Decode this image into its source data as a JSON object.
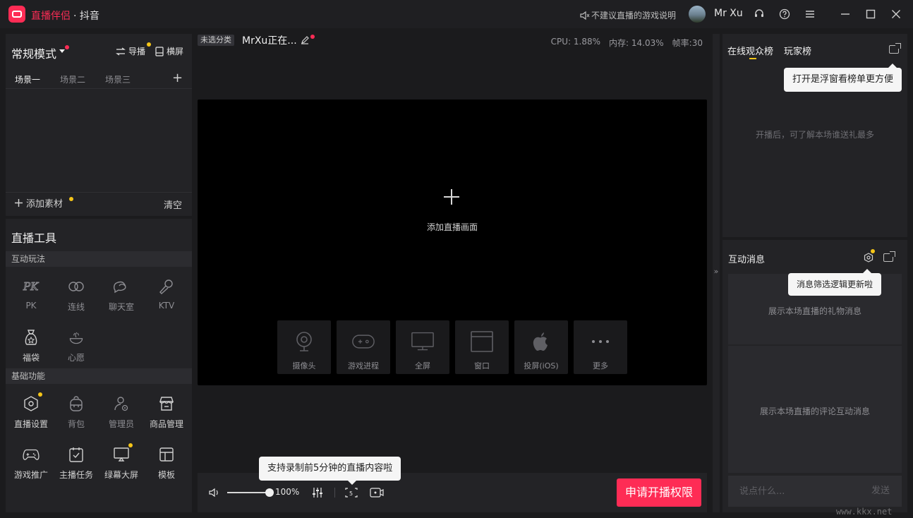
{
  "titlebar": {
    "app_name": "直播伴侣",
    "app_sub": "· 抖音",
    "notice": "不建议直播的游戏说明",
    "username": "Mr Xu"
  },
  "left": {
    "mode": "常规模式",
    "guide": "导播",
    "landscape": "横屏",
    "scenes": [
      "场景一",
      "场景二",
      "场景三"
    ],
    "add_source": "添加素材",
    "clear": "清空",
    "tools_title": "直播工具",
    "section_interactive": "互动玩法",
    "interactive_tools": [
      {
        "label": "PK",
        "icon": "pk-icon"
      },
      {
        "label": "连线",
        "icon": "link-icon"
      },
      {
        "label": "聊天室",
        "icon": "chatroom-icon"
      },
      {
        "label": "KTV",
        "icon": "microphone-icon"
      },
      {
        "label": "福袋",
        "icon": "lucky-bag-icon"
      },
      {
        "label": "心愿",
        "icon": "wish-icon"
      }
    ],
    "section_basic": "基础功能",
    "basic_tools": [
      {
        "label": "直播设置",
        "icon": "settings-hex-icon"
      },
      {
        "label": "背包",
        "icon": "backpack-icon"
      },
      {
        "label": "管理员",
        "icon": "admin-icon"
      },
      {
        "label": "商品管理",
        "icon": "store-icon"
      },
      {
        "label": "游戏推广",
        "icon": "gamepad-icon"
      },
      {
        "label": "主播任务",
        "icon": "task-icon"
      },
      {
        "label": "绿幕大屏",
        "icon": "greenscreen-icon"
      },
      {
        "label": "模板",
        "icon": "template-icon"
      }
    ]
  },
  "center": {
    "category": "未选分类",
    "stream_title": "MrXu正在...",
    "cpu": "CPU: 1.88%",
    "memory": "内存: 14.03%",
    "fps": "帧率:30",
    "add_screen": "添加直播画面",
    "sources": [
      {
        "label": "摄像头",
        "icon": "camera-icon"
      },
      {
        "label": "游戏进程",
        "icon": "game-process-icon"
      },
      {
        "label": "全屏",
        "icon": "monitor-icon"
      },
      {
        "label": "窗口",
        "icon": "window-icon"
      },
      {
        "label": "投屏(iOS)",
        "icon": "apple-icon"
      },
      {
        "label": "更多",
        "icon": "more-icon"
      }
    ],
    "record_tip": "支持录制前5分钟的直播内容啦",
    "volume": "100%",
    "volume_level": 1.0,
    "apply_button": "申请开播权限"
  },
  "right": {
    "rank_tabs": [
      "在线观众榜",
      "玩家榜"
    ],
    "rank_tip": "打开是浮窗看榜单更方便",
    "rank_empty": "开播后，可了解本场谁送礼最多",
    "messages_title": "互动消息",
    "messages_tip": "消息筛选逻辑更新啦",
    "gift_placeholder": "展示本场直播的礼物消息",
    "comment_placeholder": "展示本场直播的评论互动消息",
    "chat_placeholder": "说点什么...",
    "send": "发送"
  },
  "watermark": "www.kkx.net",
  "colors": {
    "accent": "#fe2c55",
    "badge": "#f5c518",
    "background": "#1b1b1d",
    "panel": "#232326"
  }
}
